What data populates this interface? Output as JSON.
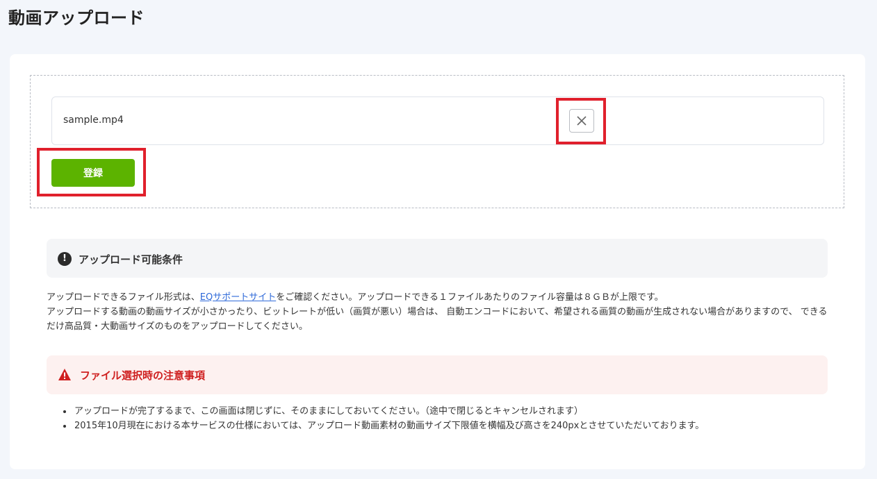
{
  "page": {
    "title": "動画アップロード"
  },
  "upload": {
    "file_name": "sample.mp4",
    "remove_icon": "close-icon",
    "submit_label": "登録"
  },
  "conditions": {
    "icon": "exclamation-icon",
    "title": "アップロード可能条件",
    "text_prefix": "アップロードできるファイル形式は、",
    "link_text": "EQサポートサイト",
    "text_suffix": "をご確認ください。アップロードできる１ファイルあたりのファイル容量は８ＧＢが上限です。",
    "text_line2": "アップロードする動画の動画サイズが小さかったり、ビットレートが低い（画質が悪い）場合は、 自動エンコードにおいて、希望される画質の動画が生成されない場合がありますので、 できるだけ高品質・大動画サイズのものをアップロードしてください。"
  },
  "warnings": {
    "icon": "warning-icon",
    "title": "ファイル選択時の注意事項",
    "items": [
      "アップロードが完了するまで、この画面は閉じずに、そのままにしておいてください。（途中で閉じるとキャンセルされます）",
      "2015年10月現在における本サービスの仕様においては、アップロード動画素材の動画サイズ下限値を横幅及び高さを240pxとさせていただいております。"
    ]
  },
  "colors": {
    "submit_bg": "#5cb300",
    "highlight": "#e0202c",
    "warning_text": "#cf2020",
    "link": "#2f6ad9"
  }
}
